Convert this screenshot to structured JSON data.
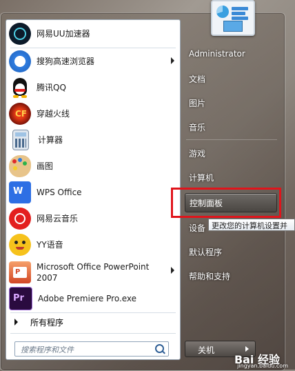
{
  "programs": [
    {
      "label": "网易UU加速器",
      "icon": "uu-accelerator-icon",
      "arrow": false
    },
    {
      "label": "搜狗高速浏览器",
      "icon": "sogou-browser-icon",
      "arrow": true
    },
    {
      "label": "腾讯QQ",
      "icon": "qq-penguin-icon",
      "arrow": false
    },
    {
      "label": "穿越火线",
      "icon": "crossfire-icon",
      "arrow": false
    },
    {
      "label": "计算器",
      "icon": "calculator-icon",
      "arrow": false
    },
    {
      "label": "画图",
      "icon": "paint-palette-icon",
      "arrow": false
    },
    {
      "label": "WPS Office",
      "icon": "wps-icon",
      "arrow": false
    },
    {
      "label": "网易云音乐",
      "icon": "netease-music-icon",
      "arrow": false
    },
    {
      "label": "YY语音",
      "icon": "yy-voice-icon",
      "arrow": false
    },
    {
      "label": "Microsoft Office PowerPoint 2007",
      "icon": "powerpoint-icon",
      "arrow": true
    },
    {
      "label": "Adobe Premiere Pro.exe",
      "icon": "premiere-icon",
      "arrow": false
    }
  ],
  "all_programs": "所有程序",
  "search_placeholder": "搜索程序和文件",
  "right": {
    "user": "Administrator",
    "documents": "文档",
    "pictures": "图片",
    "music": "音乐",
    "games": "游戏",
    "computer": "计算机",
    "control_panel": "控制面板",
    "devices": "设备",
    "default_programs": "默认程序",
    "help": "帮助和支持"
  },
  "tooltip": "更改您的计算机设置并",
  "shutdown": "关机",
  "watermark": "Bai 经验",
  "watermark_url": "jingyan.baidu.com",
  "colors": {
    "highlight": "#e0141b"
  }
}
